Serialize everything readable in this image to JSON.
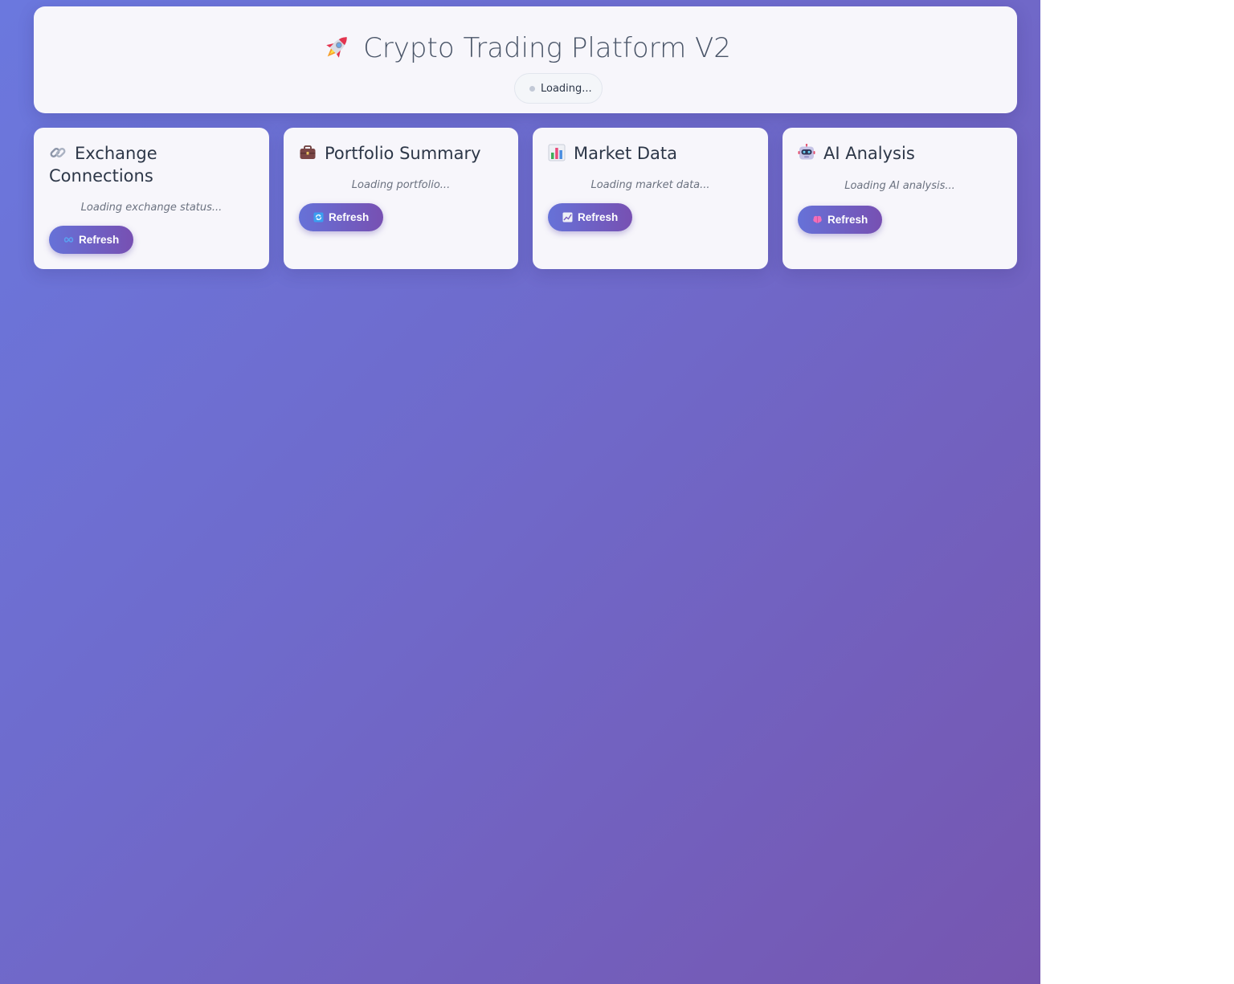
{
  "header": {
    "title": "Crypto Trading Platform V2",
    "title_icon": "rocket-icon",
    "status_text": "Loading..."
  },
  "cards": [
    {
      "title": "Exchange Connections",
      "icon": "link-icon",
      "loading_text": "Loading exchange status...",
      "button_label": "Refresh",
      "button_icon": "infinity-icon"
    },
    {
      "title": "Portfolio Summary",
      "icon": "briefcase-icon",
      "loading_text": "Loading portfolio...",
      "button_label": "Refresh",
      "button_icon": "refresh-arrows-icon"
    },
    {
      "title": "Market Data",
      "icon": "bar-chart-icon",
      "loading_text": "Loading market data...",
      "button_label": "Refresh",
      "button_icon": "trend-chart-icon"
    },
    {
      "title": "AI Analysis",
      "icon": "robot-icon",
      "loading_text": "Loading AI analysis...",
      "button_label": "Refresh",
      "button_icon": "brain-icon"
    }
  ],
  "colors": {
    "background_start": "#6b78de",
    "background_end": "#7656b0",
    "button_start": "#6672d8",
    "button_end": "#7750b2",
    "card_background": "#f7f6fb",
    "title_text": "#2d3748"
  }
}
